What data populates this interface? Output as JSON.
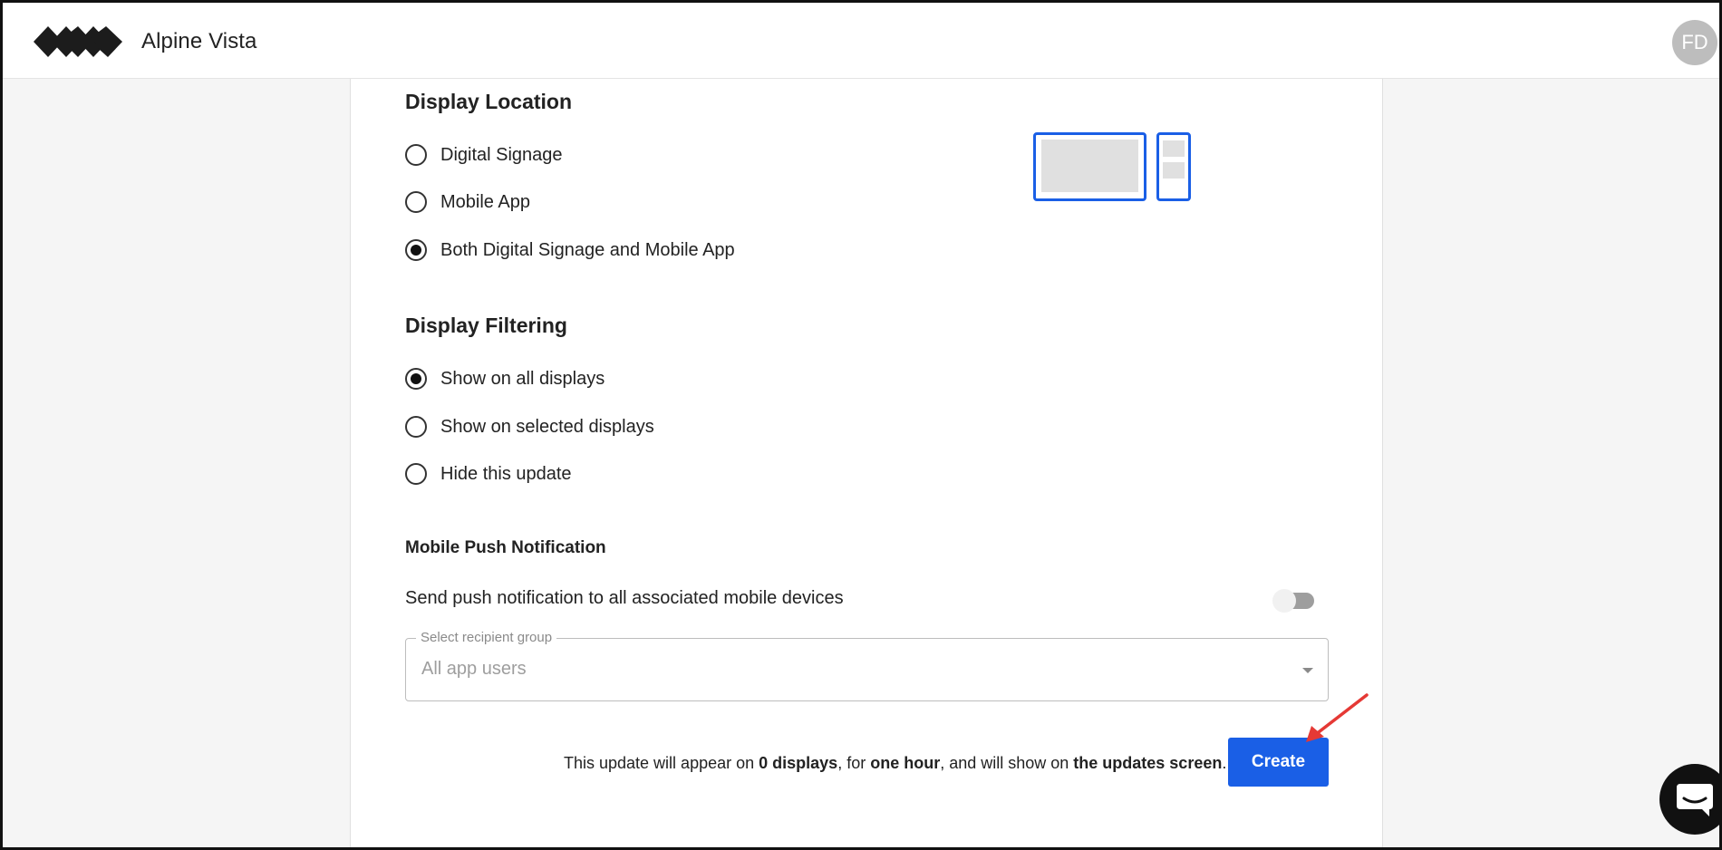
{
  "header": {
    "app_title": "Alpine Vista",
    "avatar_initials": "FD"
  },
  "display_location": {
    "title": "Display Location",
    "options": [
      {
        "label": "Digital Signage",
        "checked": false
      },
      {
        "label": "Mobile App",
        "checked": false
      },
      {
        "label": "Both Digital Signage and Mobile App",
        "checked": true
      }
    ]
  },
  "display_filtering": {
    "title": "Display Filtering",
    "options": [
      {
        "label": "Show on all displays",
        "checked": true
      },
      {
        "label": "Show on selected displays",
        "checked": false
      },
      {
        "label": "Hide this update",
        "checked": false
      }
    ]
  },
  "push_notification": {
    "title": "Mobile Push Notification",
    "toggle_label": "Send push notification to all associated mobile devices",
    "toggle_on": false,
    "recipient_select": {
      "label": "Select recipient group",
      "value": "All app users"
    }
  },
  "summary": {
    "prefix": "This update will appear on ",
    "displays": "0 displays",
    "mid1": ", for ",
    "duration": "one hour",
    "mid2": ", and will show on ",
    "screen": "the updates screen",
    "suffix": "."
  },
  "actions": {
    "create_label": "Create"
  },
  "colors": {
    "accent": "#1a5fe6",
    "annotation_arrow": "#e53935"
  },
  "icons": {
    "logo": "alpine-vista-logo",
    "chat": "chat-bubble-icon"
  }
}
